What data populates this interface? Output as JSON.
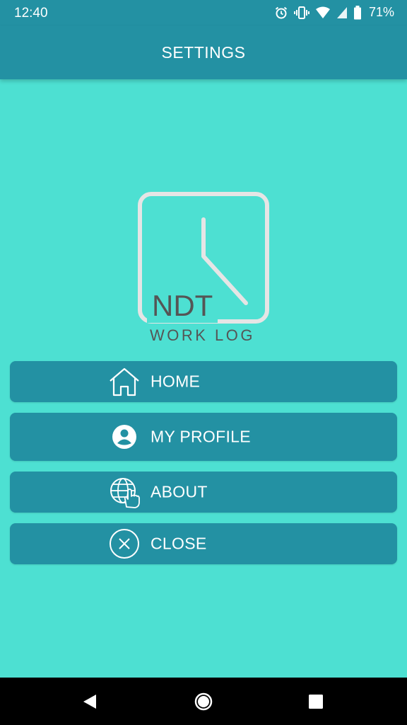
{
  "status_bar": {
    "time": "12:40",
    "battery": "71%",
    "icons": [
      "alarm-icon",
      "vibrate-icon",
      "wifi-icon",
      "signal-icon",
      "battery-icon"
    ]
  },
  "app_bar": {
    "title": "SETTINGS"
  },
  "logo": {
    "line1": "NDT",
    "line2": "WORK LOG"
  },
  "menu": {
    "home": {
      "label": "HOME",
      "icon": "home-icon"
    },
    "profile": {
      "label": "MY PROFILE",
      "icon": "profile-icon"
    },
    "about": {
      "label": "ABOUT",
      "icon": "globe-hand-icon"
    },
    "close": {
      "label": "CLOSE",
      "icon": "close-circle-icon"
    }
  },
  "nav": {
    "icons": [
      "back-icon",
      "home-circle-icon",
      "recents-icon"
    ]
  },
  "colors": {
    "background": "#4de0d2",
    "bar": "#2391a3",
    "text": "#ffffff",
    "logo_stroke": "#e5e5e5",
    "logo_text": "#555555"
  }
}
